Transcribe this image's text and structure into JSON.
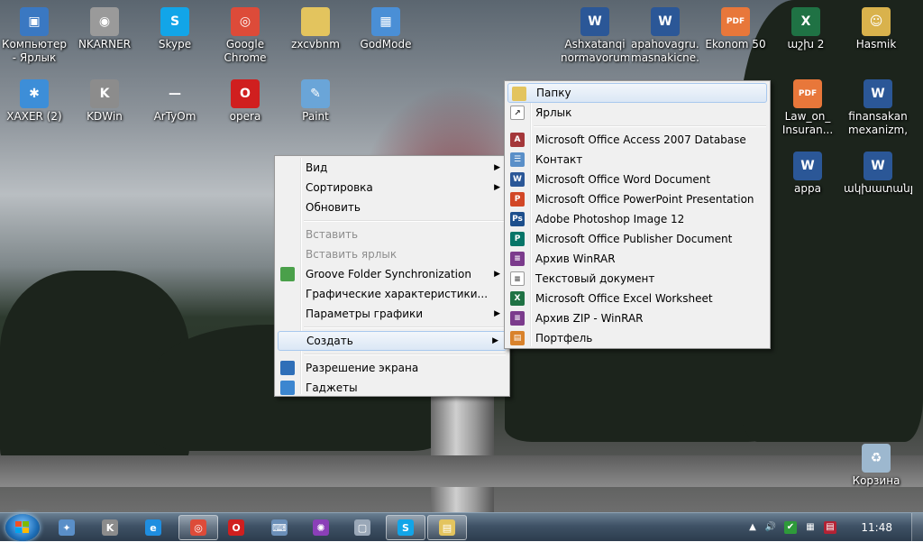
{
  "desktop": {
    "icons": [
      {
        "label": "Компьютер - Ярлык",
        "icon": "computer-icon",
        "color": "#3a78c2",
        "glyph": "▣"
      },
      {
        "label": "NKARNER",
        "icon": "camera-icon",
        "color": "#9a9a9a",
        "glyph": "◉"
      },
      {
        "label": "Skype",
        "icon": "skype-icon",
        "color": "#12a5e8",
        "glyph": "S"
      },
      {
        "label": "Google Chrome",
        "icon": "chrome-icon",
        "color": "#dd4b39",
        "glyph": "◎"
      },
      {
        "label": "zxcvbnm",
        "icon": "folder-icon",
        "color": "#e3c45e",
        "glyph": ""
      },
      {
        "label": "GodMode",
        "icon": "control-panel-icon",
        "color": "#4a8fd6",
        "glyph": "▦"
      },
      {
        "label": "Ashxatanqi normavorum...",
        "icon": "word-document-icon",
        "color": "#2b5797",
        "glyph": "W"
      },
      {
        "label": "apahovagru... masnakicne...",
        "icon": "word-document-icon",
        "color": "#2b5797",
        "glyph": "W"
      },
      {
        "label": "Ekonom 50",
        "icon": "pdf-icon",
        "color": "#e8773a",
        "glyph": "PDF"
      },
      {
        "label": "աշխ 2",
        "icon": "excel-icon",
        "color": "#1f7244",
        "glyph": "X"
      },
      {
        "label": "Hasmik",
        "icon": "user-folder-icon",
        "color": "#d9b24c",
        "glyph": "☺"
      },
      {
        "label": "XAXER (2)",
        "icon": "msn-butterfly-icon",
        "color": "#3d8ed8",
        "glyph": "✱"
      },
      {
        "label": "KDWin",
        "icon": "kdwin-icon",
        "color": "#8c8c8c",
        "glyph": "K"
      },
      {
        "label": "ArTyOm",
        "icon": "blank-icon",
        "color": "transparent",
        "glyph": "—"
      },
      {
        "label": "opera",
        "icon": "opera-icon",
        "color": "#d01f1f",
        "glyph": "O"
      },
      {
        "label": "Paint",
        "icon": "paint-icon",
        "color": "#6aa5d8",
        "glyph": "✎"
      },
      {
        "label": "Law_on_ Insuran...",
        "icon": "pdf-icon",
        "color": "#e8773a",
        "glyph": "PDF"
      },
      {
        "label": "finansakan mexanizm, f...",
        "icon": "word-document-icon",
        "color": "#2b5797",
        "glyph": "W"
      },
      {
        "label": "appa",
        "icon": "word-document-icon",
        "color": "#2b5797",
        "glyph": "W"
      },
      {
        "label": "ակխատանք",
        "icon": "word-document-icon",
        "color": "#2b5797",
        "glyph": "W"
      },
      {
        "label": "Корзина",
        "icon": "recycle-bin-icon",
        "color": "#9db8cf",
        "glyph": "♻"
      }
    ]
  },
  "context_menu": {
    "items": [
      {
        "type": "item",
        "label": "Вид",
        "submenu": true,
        "state": "normal",
        "icon": ""
      },
      {
        "type": "item",
        "label": "Сортировка",
        "submenu": true,
        "state": "normal",
        "icon": ""
      },
      {
        "type": "item",
        "label": "Обновить",
        "submenu": false,
        "state": "normal",
        "icon": ""
      },
      {
        "type": "separator"
      },
      {
        "type": "item",
        "label": "Вставить",
        "submenu": false,
        "state": "disabled",
        "icon": ""
      },
      {
        "type": "item",
        "label": "Вставить ярлык",
        "submenu": false,
        "state": "disabled",
        "icon": ""
      },
      {
        "type": "item",
        "label": "Groove Folder Synchronization",
        "submenu": true,
        "state": "normal",
        "icon": "groove-sync-icon",
        "icon_color": "#4aa04a"
      },
      {
        "type": "item",
        "label": "Графические характеристики...",
        "submenu": false,
        "state": "normal",
        "icon": ""
      },
      {
        "type": "item",
        "label": "Параметры графики",
        "submenu": true,
        "state": "normal",
        "icon": ""
      },
      {
        "type": "separator"
      },
      {
        "type": "item",
        "label": "Создать",
        "submenu": true,
        "state": "highlighted",
        "icon": ""
      },
      {
        "type": "separator"
      },
      {
        "type": "item",
        "label": "Разрешение экрана",
        "submenu": false,
        "state": "normal",
        "icon": "display-icon",
        "icon_color": "#2f6fb8"
      },
      {
        "type": "item",
        "label": "Гаджеты",
        "submenu": false,
        "state": "normal",
        "icon": "gadgets-icon",
        "icon_color": "#3c86d0"
      }
    ]
  },
  "create_submenu": {
    "items": [
      {
        "type": "item",
        "label": "Папку",
        "state": "highlighted",
        "icon": "folder-icon",
        "icon_color": "#e3c45e",
        "glyph": ""
      },
      {
        "type": "item",
        "label": "Ярлык",
        "state": "normal",
        "icon": "shortcut-icon",
        "icon_color": "#ffffff",
        "glyph": "↗"
      },
      {
        "type": "separator"
      },
      {
        "type": "item",
        "label": "Microsoft Office Access 2007 Database",
        "state": "normal",
        "icon": "access-icon",
        "icon_color": "#a4373a",
        "glyph": "A"
      },
      {
        "type": "item",
        "label": "Контакт",
        "state": "normal",
        "icon": "contact-icon",
        "icon_color": "#5a8fc8",
        "glyph": "☰"
      },
      {
        "type": "item",
        "label": "Microsoft Office Word Document",
        "state": "normal",
        "icon": "word-icon",
        "icon_color": "#2b5797",
        "glyph": "W"
      },
      {
        "type": "item",
        "label": "Microsoft Office PowerPoint Presentation",
        "state": "normal",
        "icon": "powerpoint-icon",
        "icon_color": "#d24726",
        "glyph": "P"
      },
      {
        "type": "item",
        "label": "Adobe Photoshop Image 12",
        "state": "normal",
        "icon": "photoshop-icon",
        "icon_color": "#1d4f8c",
        "glyph": "Ps"
      },
      {
        "type": "item",
        "label": "Microsoft Office Publisher Document",
        "state": "normal",
        "icon": "publisher-icon",
        "icon_color": "#077568",
        "glyph": "P"
      },
      {
        "type": "item",
        "label": "Архив WinRAR",
        "state": "normal",
        "icon": "winrar-icon",
        "icon_color": "#7b3b8c",
        "glyph": "≡"
      },
      {
        "type": "item",
        "label": "Текстовый документ",
        "state": "normal",
        "icon": "text-document-icon",
        "icon_color": "#ffffff",
        "glyph": "≡"
      },
      {
        "type": "item",
        "label": "Microsoft Office Excel Worksheet",
        "state": "normal",
        "icon": "excel-icon",
        "icon_color": "#1f7244",
        "glyph": "X"
      },
      {
        "type": "item",
        "label": "Архив ZIP - WinRAR",
        "state": "normal",
        "icon": "winrar-zip-icon",
        "icon_color": "#7b3b8c",
        "glyph": "≡"
      },
      {
        "type": "item",
        "label": "Портфель",
        "state": "normal",
        "icon": "briefcase-icon",
        "icon_color": "#d9822b",
        "glyph": "▤"
      }
    ]
  },
  "taskbar": {
    "start_icon": "windows-start-icon",
    "buttons": [
      {
        "icon": "user-accounts-icon",
        "color": "#5a8fc8",
        "glyph": "✦",
        "active": false
      },
      {
        "icon": "kdwin-icon",
        "color": "#8c8c8c",
        "glyph": "K",
        "active": false
      },
      {
        "icon": "internet-explorer-icon",
        "color": "#1f8ee0",
        "glyph": "e",
        "active": false
      },
      {
        "icon": "chrome-icon",
        "color": "#dd4b39",
        "glyph": "◎",
        "active": true
      },
      {
        "icon": "opera-icon",
        "color": "#d01f1f",
        "glyph": "O",
        "active": false
      },
      {
        "icon": "keyboard-icon",
        "color": "#6b8fb8",
        "glyph": "⌨",
        "active": false
      },
      {
        "icon": "spider-icon",
        "color": "#8b3fb8",
        "glyph": "✺",
        "active": false
      },
      {
        "icon": "window-icon",
        "color": "#9aa8b8",
        "glyph": "▢",
        "active": false
      },
      {
        "icon": "skype-icon",
        "color": "#12a5e8",
        "glyph": "S",
        "active": true
      },
      {
        "icon": "explorer-icon",
        "color": "#e3c45e",
        "glyph": "▤",
        "active": true
      }
    ],
    "tray": {
      "icons": [
        {
          "icon": "show-hidden-icons-arrow",
          "color": "transparent",
          "glyph": "▲"
        },
        {
          "icon": "volume-icon",
          "color": "transparent",
          "glyph": "🔊"
        },
        {
          "icon": "sync-check-icon",
          "color": "#2e9a3a",
          "glyph": "✔"
        },
        {
          "icon": "network-icon",
          "color": "transparent",
          "glyph": "▦"
        },
        {
          "icon": "language-flag-icon",
          "color": "#b22234",
          "glyph": "▤"
        }
      ],
      "clock": "11:48"
    }
  }
}
